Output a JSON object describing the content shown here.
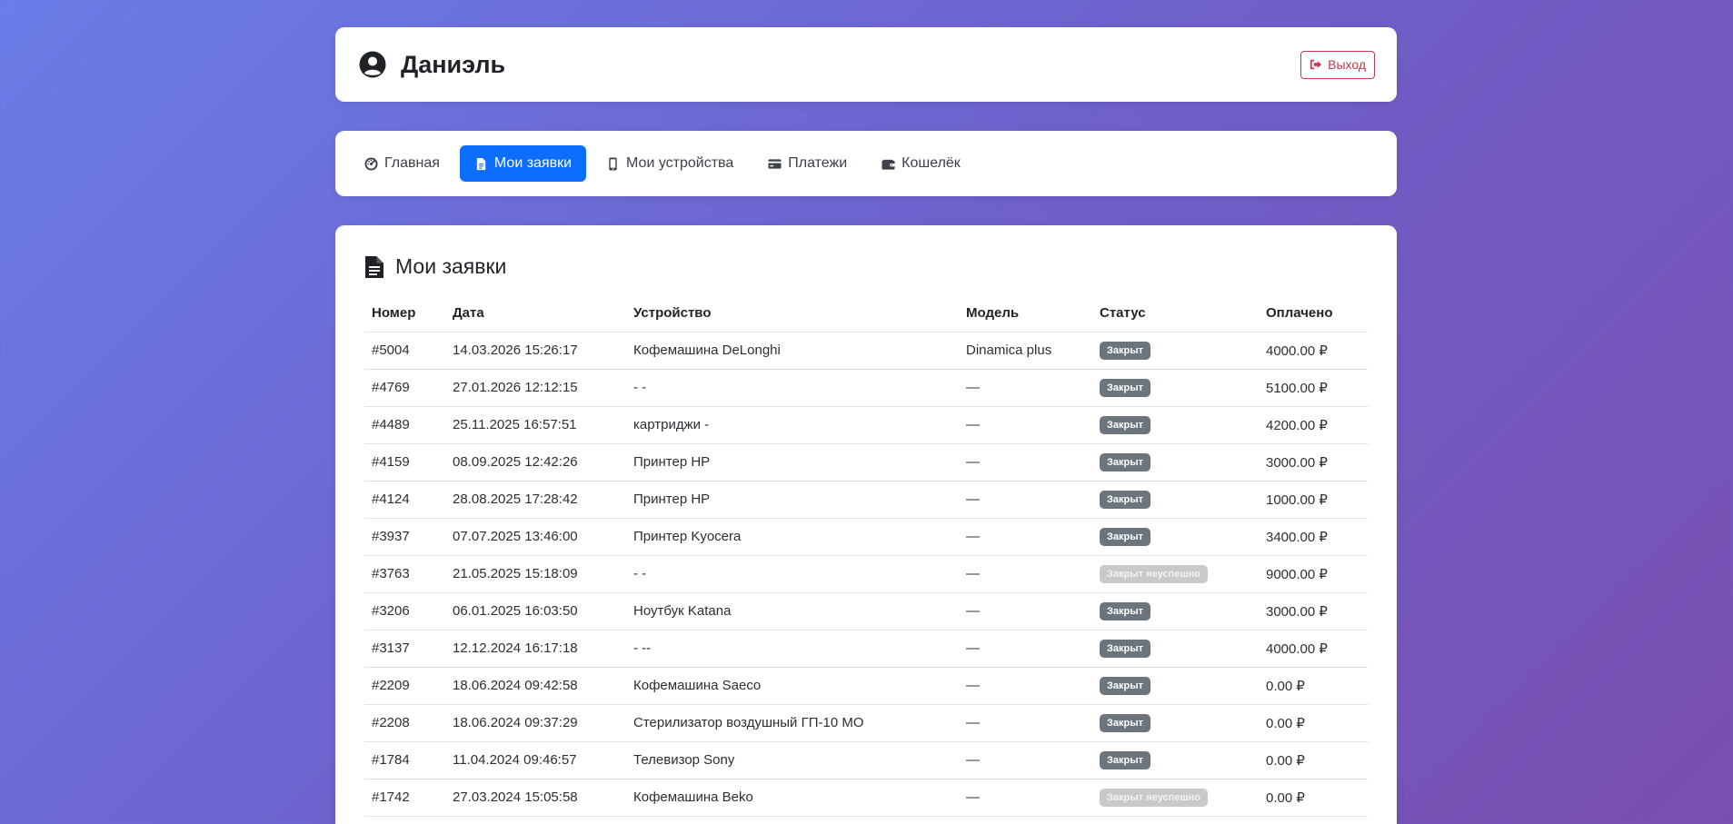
{
  "header": {
    "user_name": "Даниэль",
    "logout_label": "Выход"
  },
  "nav": {
    "items": [
      {
        "label": "Главная",
        "icon": "dashboard-icon",
        "active": false
      },
      {
        "label": "Мои заявки",
        "icon": "file-icon",
        "active": true
      },
      {
        "label": "Мои устройства",
        "icon": "mobile-icon",
        "active": false
      },
      {
        "label": "Платежи",
        "icon": "credit-card-icon",
        "active": false
      },
      {
        "label": "Кошелёк",
        "icon": "wallet-icon",
        "active": false
      }
    ]
  },
  "main": {
    "title": "Мои заявки",
    "columns": [
      "Номер",
      "Дата",
      "Устройство",
      "Модель",
      "Статус",
      "Оплачено"
    ],
    "rows": [
      {
        "num": "#5004",
        "date": "14.03.2026 15:26:17",
        "device": "Кофемашина DeLonghi",
        "model": "Dinamica plus",
        "status": "Закрыт",
        "status_type": "closed",
        "paid": "4000.00 ₽"
      },
      {
        "num": "#4769",
        "date": "27.01.2026 12:12:15",
        "device": "- -",
        "model": "—",
        "status": "Закрыт",
        "status_type": "closed",
        "paid": "5100.00 ₽"
      },
      {
        "num": "#4489",
        "date": "25.11.2025 16:57:51",
        "device": "картриджи -",
        "model": "—",
        "status": "Закрыт",
        "status_type": "closed",
        "paid": "4200.00 ₽"
      },
      {
        "num": "#4159",
        "date": "08.09.2025 12:42:26",
        "device": "Принтер HP",
        "model": "—",
        "status": "Закрыт",
        "status_type": "closed",
        "paid": "3000.00 ₽"
      },
      {
        "num": "#4124",
        "date": "28.08.2025 17:28:42",
        "device": "Принтер HP",
        "model": "—",
        "status": "Закрыт",
        "status_type": "closed",
        "paid": "1000.00 ₽"
      },
      {
        "num": "#3937",
        "date": "07.07.2025 13:46:00",
        "device": "Принтер Kyocera",
        "model": "—",
        "status": "Закрыт",
        "status_type": "closed",
        "paid": "3400.00 ₽"
      },
      {
        "num": "#3763",
        "date": "21.05.2025 15:18:09",
        "device": "- -",
        "model": "—",
        "status": "Закрыт неуспешно",
        "status_type": "failed",
        "paid": "9000.00 ₽"
      },
      {
        "num": "#3206",
        "date": "06.01.2025 16:03:50",
        "device": "Ноутбук Katana",
        "model": "—",
        "status": "Закрыт",
        "status_type": "closed",
        "paid": "3000.00 ₽"
      },
      {
        "num": "#3137",
        "date": "12.12.2024 16:17:18",
        "device": "- --",
        "model": "—",
        "status": "Закрыт",
        "status_type": "closed",
        "paid": "4000.00 ₽"
      },
      {
        "num": "#2209",
        "date": "18.06.2024 09:42:58",
        "device": "Кофемашина Saeco",
        "model": "—",
        "status": "Закрыт",
        "status_type": "closed",
        "paid": "0.00 ₽"
      },
      {
        "num": "#2208",
        "date": "18.06.2024 09:37:29",
        "device": "Стерилизатор воздушный ГП-10 МО",
        "model": "—",
        "status": "Закрыт",
        "status_type": "closed",
        "paid": "0.00 ₽"
      },
      {
        "num": "#1784",
        "date": "11.04.2024 09:46:57",
        "device": "Телевизор Sony",
        "model": "—",
        "status": "Закрыт",
        "status_type": "closed",
        "paid": "0.00 ₽"
      },
      {
        "num": "#1742",
        "date": "27.03.2024 15:05:58",
        "device": "Кофемашина Beko",
        "model": "—",
        "status": "Закрыт неуспешно",
        "status_type": "failed",
        "paid": "0.00 ₽"
      }
    ]
  },
  "colors": {
    "accent": "#0d6efd",
    "danger": "#c7374a",
    "badge_closed": "#6c757d",
    "badge_failed": "#c9c9c9"
  }
}
